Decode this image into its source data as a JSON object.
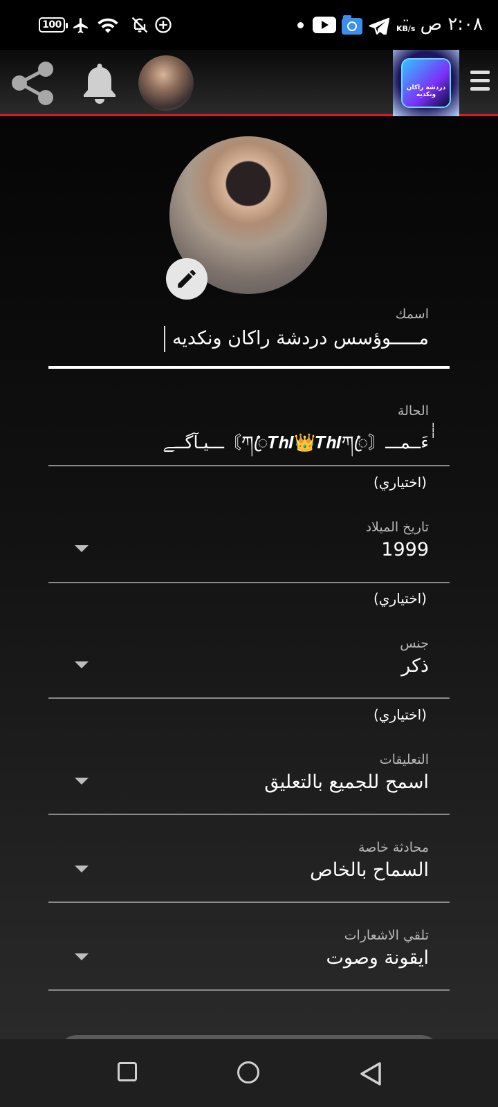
{
  "status_bar": {
    "time": "٢:٠٨ ص",
    "battery": "100",
    "net_speed_unit": "KB/s",
    "icons": [
      "battery-icon",
      "airplane-icon",
      "wifi-icon",
      "bell-off-icon",
      "data-saver-icon",
      "dot-icon",
      "youtube-icon",
      "file-manager-icon",
      "telegram-icon"
    ]
  },
  "app_bar": {
    "logo_text": "دردشة راكان ونكديه",
    "accent_color": "#d81b1b"
  },
  "profile": {
    "name_label": "اسمك",
    "name_value": "مـــــوؤسس دردشة راكان ونكديه",
    "status_label": "الحالة",
    "status_value": "ٰٰٰٰٰءَــمـــ〘ཀ٘ꦿ𝑻𝒉𝑰👑𝑻𝒉𝑰ཀ٘ꦿ〙ـــيـآگــﮯ",
    "optional_hint": "(اختياري)",
    "birth_label": "تاريخ الميلاد",
    "birth_value": "1999",
    "gender_label": "جنس",
    "gender_value": "ذكر",
    "comments_label": "التعليقات",
    "comments_value": "اسمح للجميع بالتعليق",
    "private_chat_label": "محادثة خاصة",
    "private_chat_value": "السماح بالخاص",
    "notifications_label": "تلقي الاشعارات",
    "notifications_value": "ايقونة وصوت"
  }
}
